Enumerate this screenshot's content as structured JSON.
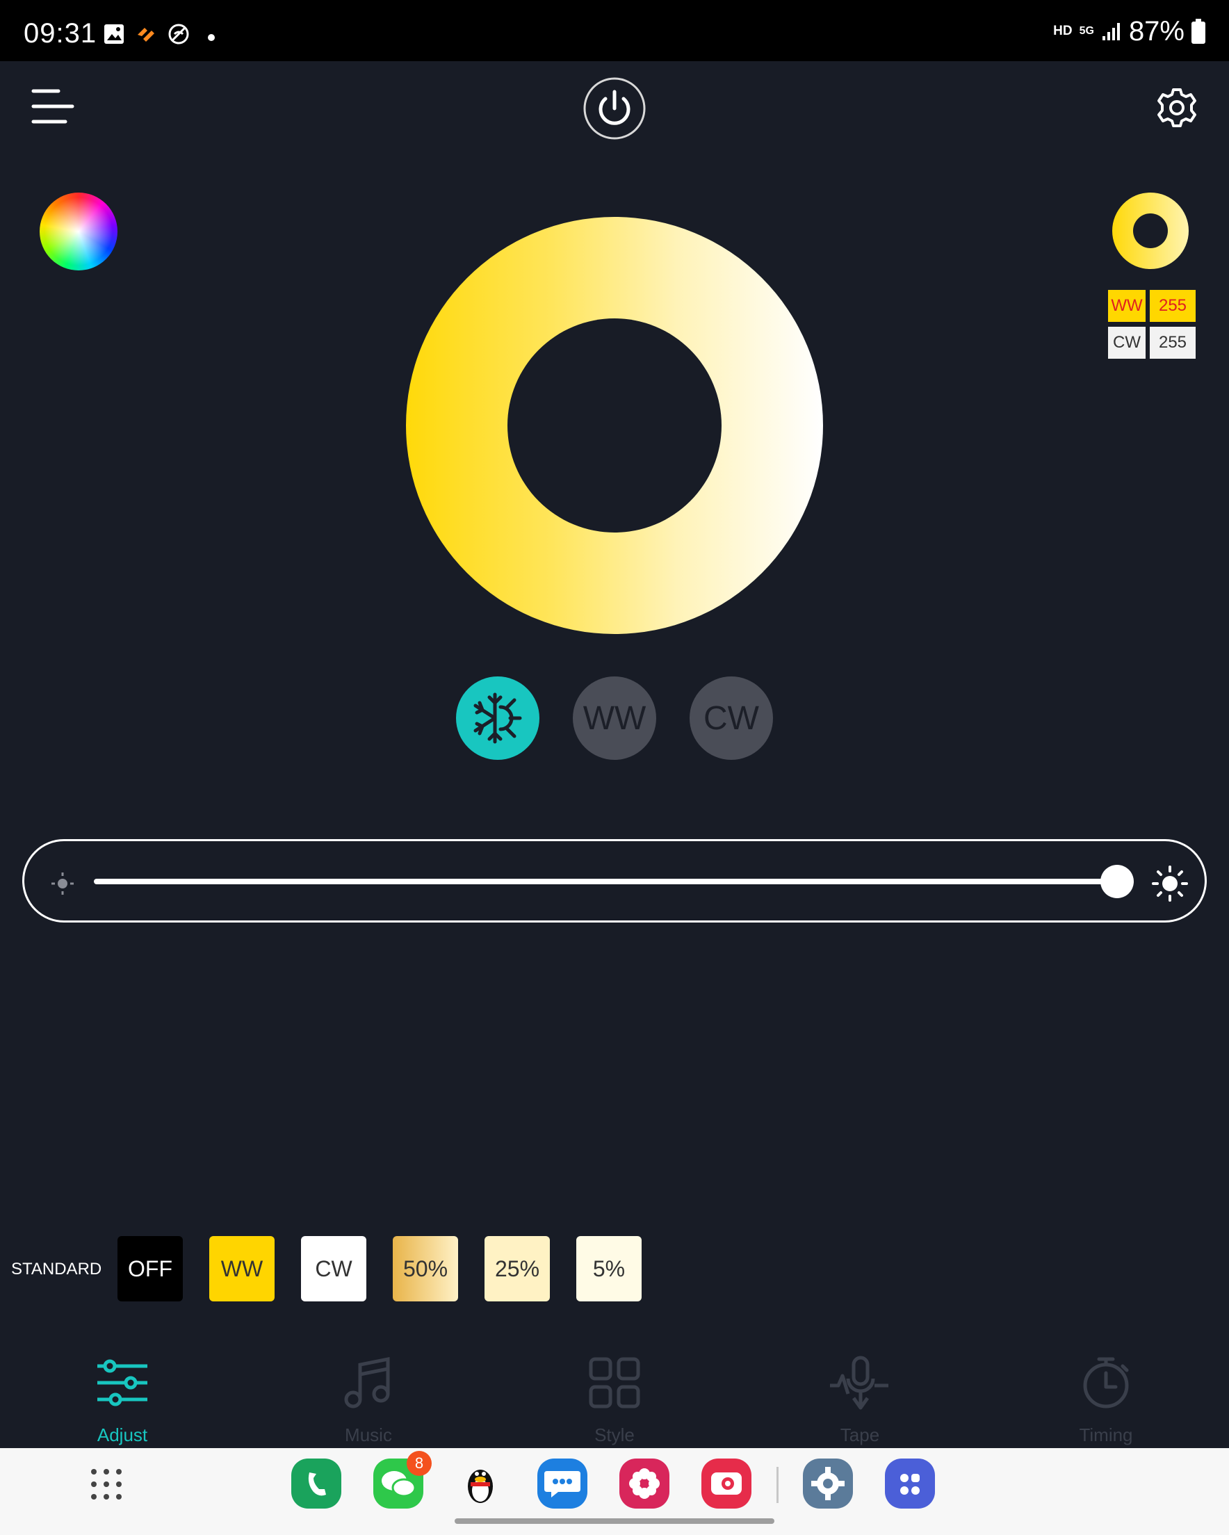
{
  "status_bar": {
    "time": "09:31",
    "network_hd": "HD",
    "network_5g": "5G",
    "battery": "87%",
    "left_icons": [
      "gallery-icon",
      "app-notification-icon",
      "no-signal-icon",
      "dot-icon"
    ]
  },
  "top_bar": {
    "menu_icon": "menu-icon",
    "power_icon": "power-icon",
    "settings_icon": "gear-icon"
  },
  "color_values": {
    "ww_label": "WW",
    "ww_value": "255",
    "cw_label": "CW",
    "cw_value": "255"
  },
  "modes": {
    "ww": "WW",
    "cw": "CW"
  },
  "brightness": {
    "level": 1.0
  },
  "standard": {
    "label": "STANDARD",
    "presets": [
      {
        "label": "OFF",
        "bg": "#000000",
        "fg": "#ffffff"
      },
      {
        "label": "WW",
        "bg": "#ffd500",
        "fg": "#333333"
      },
      {
        "label": "CW",
        "bg": "#ffffff",
        "fg": "#333333"
      },
      {
        "label": "50%",
        "bg": "#e8b85a",
        "fg": "#333333"
      },
      {
        "label": "25%",
        "bg": "#fff2c4",
        "fg": "#333333"
      },
      {
        "label": "5%",
        "bg": "#fffbe6",
        "fg": "#333333"
      }
    ]
  },
  "nav": {
    "items": [
      {
        "label": "Adjust",
        "icon": "sliders-icon",
        "active": true
      },
      {
        "label": "Music",
        "icon": "music-note-icon",
        "active": false
      },
      {
        "label": "Style",
        "icon": "grid-icon",
        "active": false
      },
      {
        "label": "Tape",
        "icon": "microphone-icon",
        "active": false
      },
      {
        "label": "Timing",
        "icon": "stopwatch-icon",
        "active": false
      }
    ]
  },
  "dock": {
    "wechat_badge": "8",
    "apps": [
      "app-drawer-icon",
      "phone-icon",
      "wechat-icon",
      "qq-icon",
      "messages-icon",
      "gallery-app-icon",
      "camera-icon",
      "settings-app-icon",
      "apps-folder-icon"
    ]
  },
  "colors": {
    "accent": "#18c6c0",
    "background": "#181c26",
    "ww_yellow": "#ffd700"
  }
}
